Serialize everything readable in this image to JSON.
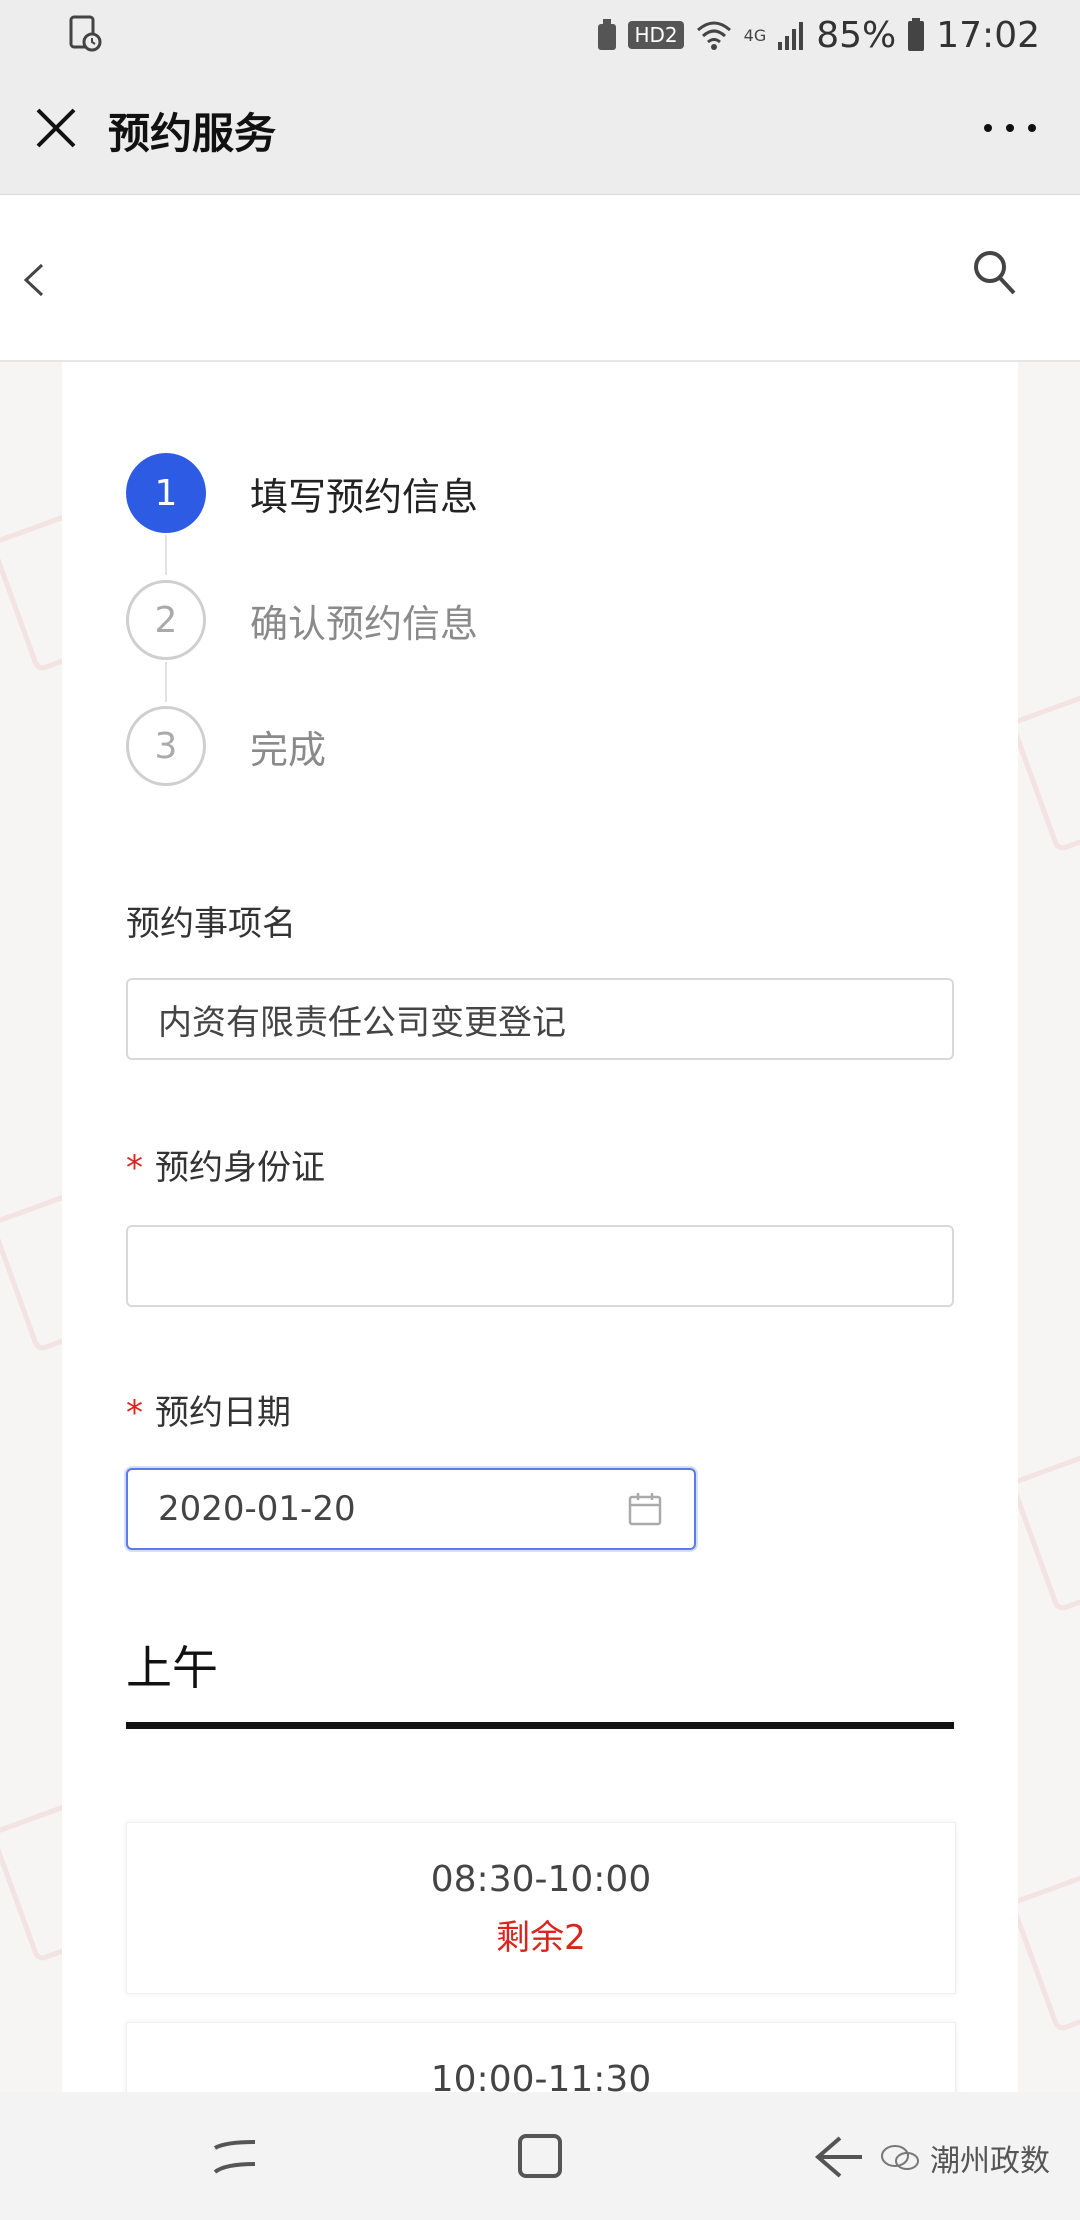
{
  "status_bar": {
    "hd_label": "HD2",
    "network_label": "4G",
    "battery": "85%",
    "time": "17:02"
  },
  "title_bar": {
    "title": "预约服务"
  },
  "steps": [
    {
      "number": "1",
      "label": "填写预约信息",
      "state": "active"
    },
    {
      "number": "2",
      "label": "确认预约信息",
      "state": "inactive"
    },
    {
      "number": "3",
      "label": "完成",
      "state": "inactive"
    }
  ],
  "form": {
    "item_name": {
      "label": "预约事项名",
      "value": "内资有限责任公司变更登记"
    },
    "id_card": {
      "required_mark": "*",
      "label": "预约身份证",
      "value": ""
    },
    "date": {
      "required_mark": "*",
      "label": "预约日期",
      "value": "2020-01-20"
    }
  },
  "morning": {
    "title": "上午",
    "slots": [
      {
        "time": "08:30-10:00",
        "remaining": "剩余2"
      },
      {
        "time": "10:00-11:30",
        "remaining": ""
      }
    ]
  },
  "footer_watermark": "潮州政数",
  "colors": {
    "accent": "#2e5be3",
    "required": "#d9251d",
    "remaining": "#d9251d"
  }
}
